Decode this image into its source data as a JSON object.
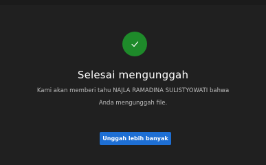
{
  "status": {
    "icon": "checkmark-icon",
    "accent_color": "#1e8a2a"
  },
  "title": "Selesai mengunggah",
  "message": {
    "line1": "Kami akan memberi tahu NAJLA RAMADINA SULISTYOWATI bahwa",
    "line2": "Anda mengunggah file."
  },
  "actions": {
    "upload_more_label": "Unggah lebih banyak",
    "button_color": "#1e6fd4"
  }
}
